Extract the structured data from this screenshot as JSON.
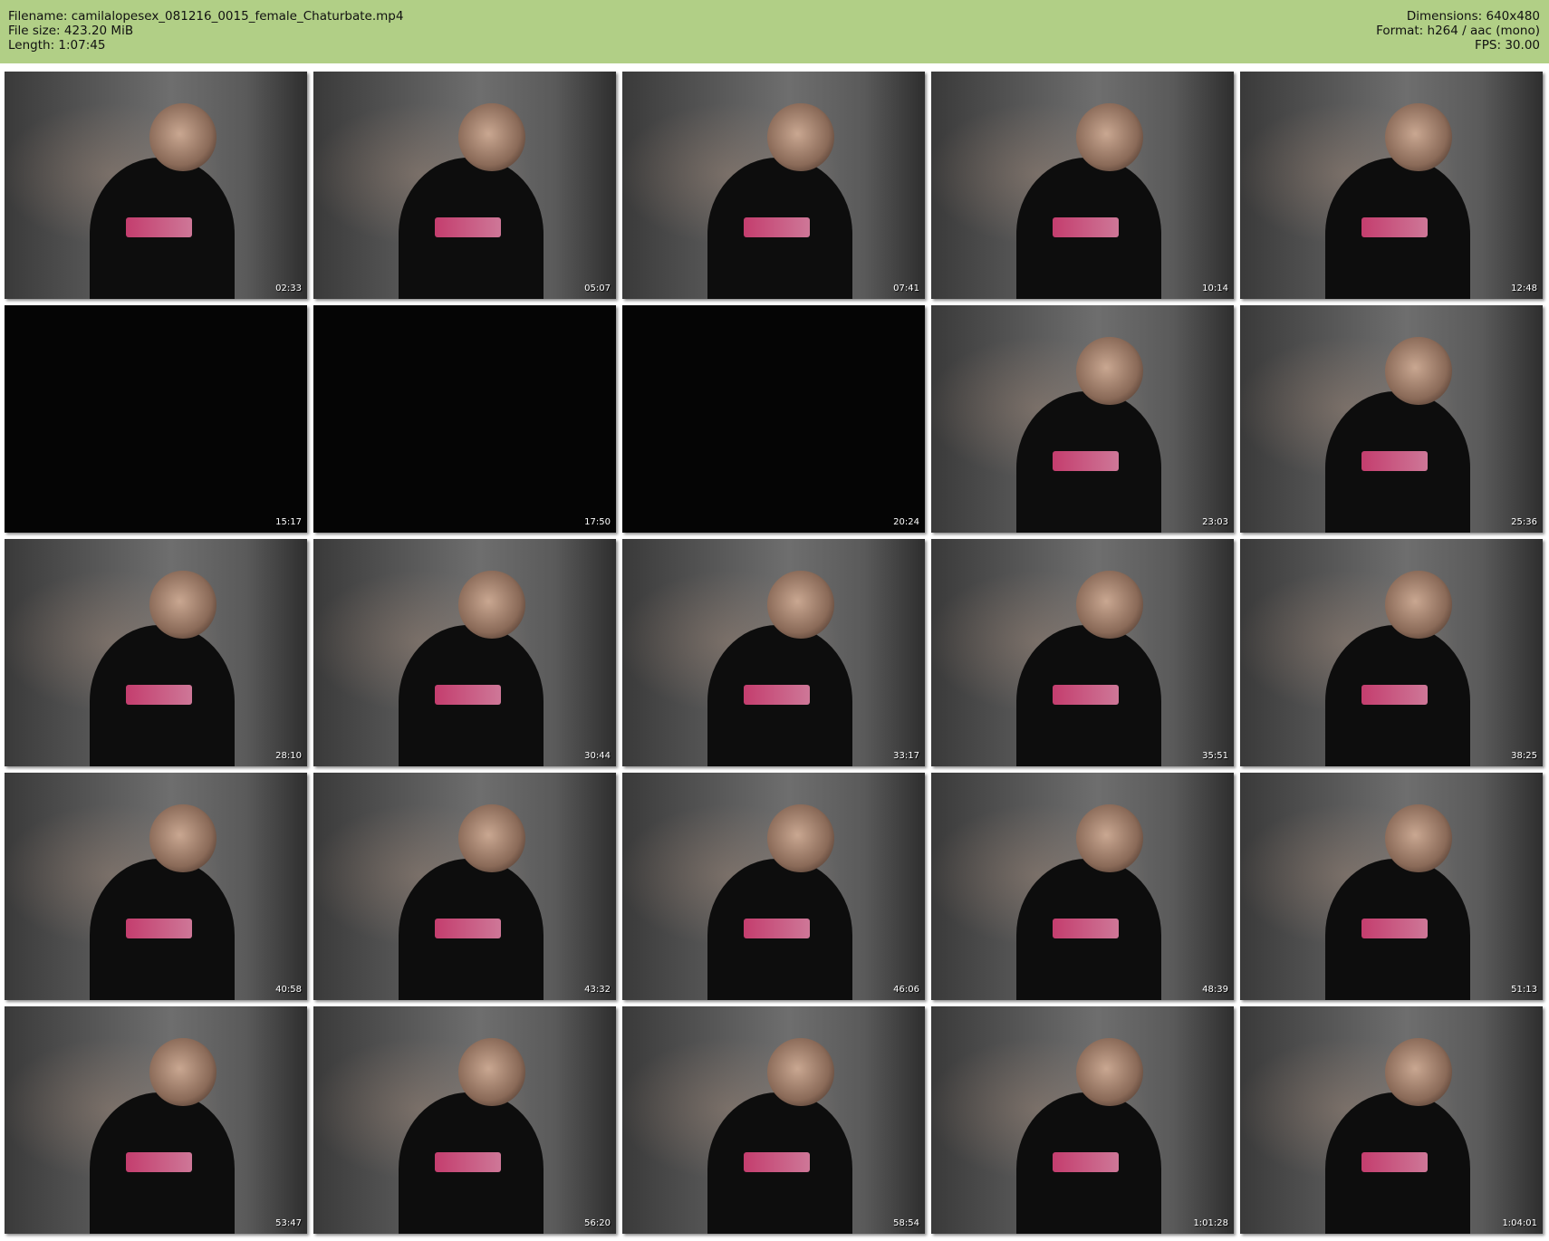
{
  "header": {
    "filename": "Filename: camilalopesex_081216_0015_female_Chaturbate.mp4",
    "file_size": "File size: 423.20 MiB",
    "length": "Length: 1:07:45",
    "dimensions": "Dimensions: 640x480",
    "format": "Format: h264 / aac (mono)",
    "fps": "FPS: 30.00"
  },
  "thumbnails": [
    {
      "time": "02:33",
      "kind": "scene"
    },
    {
      "time": "05:07",
      "kind": "scene"
    },
    {
      "time": "07:41",
      "kind": "scene"
    },
    {
      "time": "10:14",
      "kind": "scene"
    },
    {
      "time": "12:48",
      "kind": "scene"
    },
    {
      "time": "15:17",
      "kind": "dark"
    },
    {
      "time": "17:50",
      "kind": "dark"
    },
    {
      "time": "20:24",
      "kind": "dark"
    },
    {
      "time": "23:03",
      "kind": "scene"
    },
    {
      "time": "25:36",
      "kind": "scene"
    },
    {
      "time": "28:10",
      "kind": "scene"
    },
    {
      "time": "30:44",
      "kind": "scene"
    },
    {
      "time": "33:17",
      "kind": "scene"
    },
    {
      "time": "35:51",
      "kind": "scene"
    },
    {
      "time": "38:25",
      "kind": "scene"
    },
    {
      "time": "40:58",
      "kind": "scene"
    },
    {
      "time": "43:32",
      "kind": "scene"
    },
    {
      "time": "46:06",
      "kind": "scene"
    },
    {
      "time": "48:39",
      "kind": "scene"
    },
    {
      "time": "51:13",
      "kind": "scene"
    },
    {
      "time": "53:47",
      "kind": "scene"
    },
    {
      "time": "56:20",
      "kind": "scene"
    },
    {
      "time": "58:54",
      "kind": "scene"
    },
    {
      "time": "1:01:28",
      "kind": "scene"
    },
    {
      "time": "1:04:01",
      "kind": "scene"
    }
  ]
}
